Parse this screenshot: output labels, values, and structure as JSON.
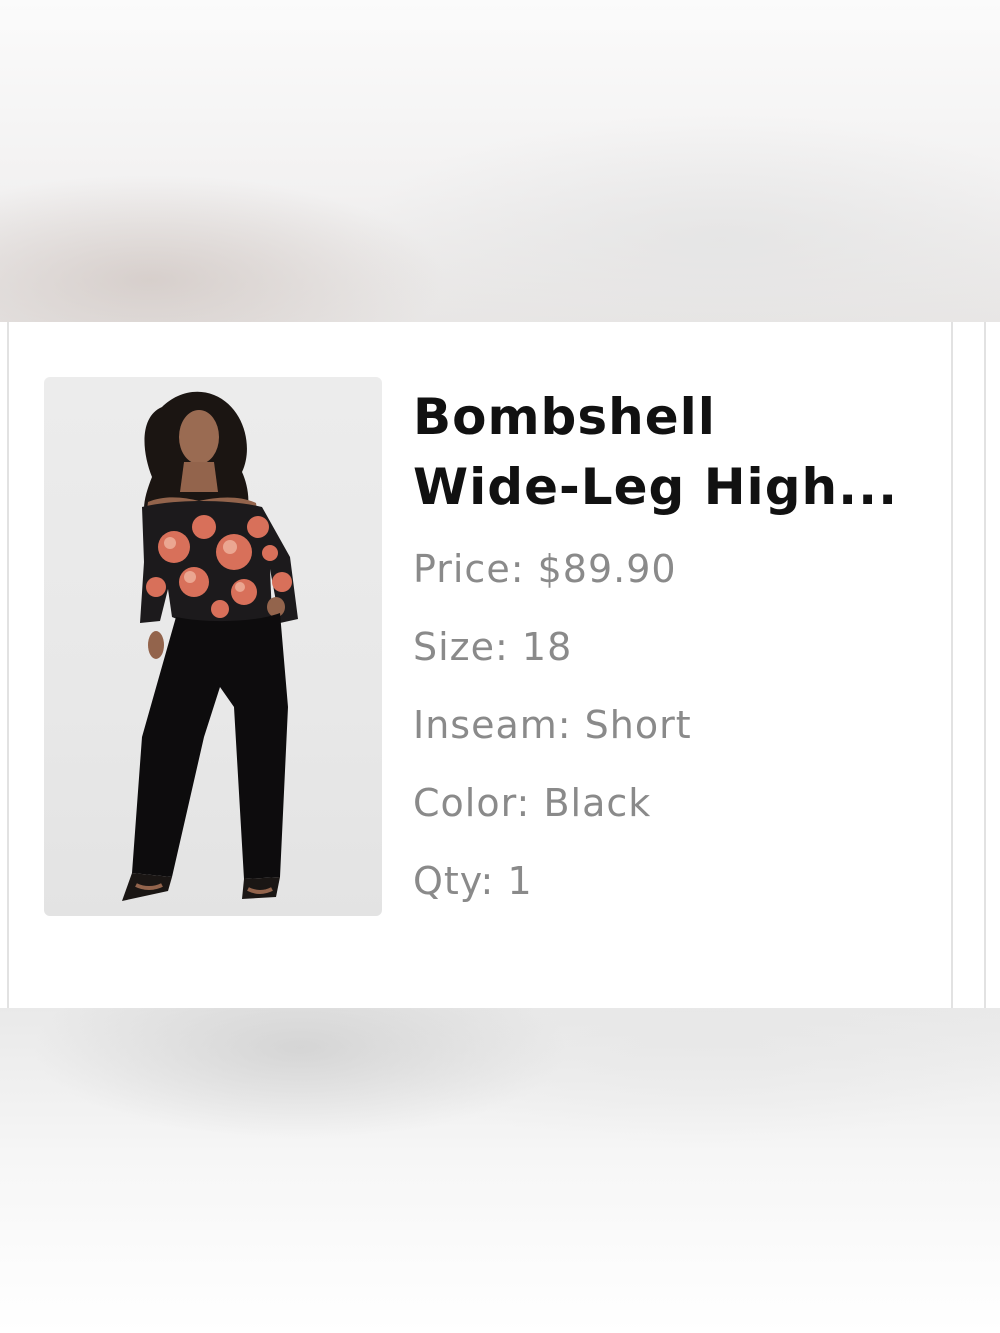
{
  "product": {
    "title_line1": "Bombshell",
    "title_line2": "Wide-Leg High...",
    "image_icon": "product-photo",
    "attributes": [
      {
        "label": "Price:",
        "value": "$89.90"
      },
      {
        "label": "Size:",
        "value": "18"
      },
      {
        "label": "Inseam:",
        "value": "Short"
      },
      {
        "label": "Color:",
        "value": "Black"
      },
      {
        "label": "Qty:",
        "value": "1"
      }
    ]
  },
  "colors": {
    "title": "#111111",
    "attribute_text": "#8a8a8a",
    "card_border": "#e2e2e2",
    "image_background": "#e8e8e8"
  }
}
